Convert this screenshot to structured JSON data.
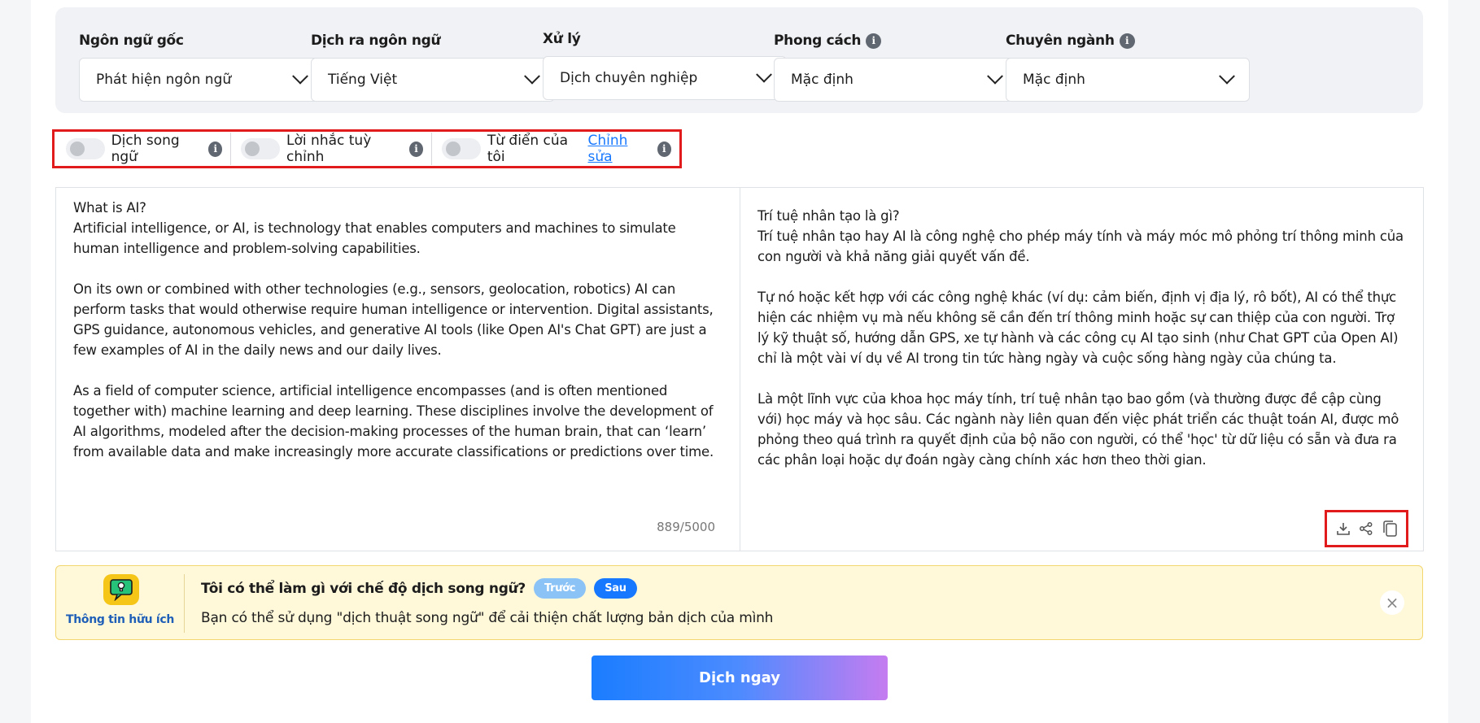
{
  "filters": [
    {
      "label": "Ngôn ngữ gốc",
      "value": "Phát hiện ngôn ngữ",
      "info": false
    },
    {
      "label": "Dịch ra ngôn ngữ",
      "value": "Tiếng Việt",
      "info": false
    },
    {
      "label": "Xử lý",
      "value": "Dịch chuyên nghiệp",
      "info": false
    },
    {
      "label": "Phong cách",
      "value": "Mặc định",
      "info": true
    },
    {
      "label": "Chuyên ngành",
      "value": "Mặc định",
      "info": true
    }
  ],
  "options": {
    "bilingual": "Dịch song ngữ",
    "custom_prompt": "Lời nhắc tuỳ chỉnh",
    "my_dictionary": "Từ điển của tôi",
    "edit_link": "Chỉnh sửa"
  },
  "source": {
    "text": "What is AI?\nArtificial intelligence, or AI, is technology that enables computers and machines to simulate human intelligence and problem-solving capabilities.\n\nOn its own or combined with other technologies (e.g., sensors, geolocation, robotics) AI can perform tasks that would otherwise require human intelligence or intervention. Digital assistants, GPS guidance, autonomous vehicles, and generative AI tools (like Open AI's Chat GPT) are just a few examples of AI in the daily news and our daily lives.\n\nAs a field of computer science, artificial intelligence encompasses (and is often mentioned together with) machine learning and deep learning. These disciplines involve the development of AI algorithms, modeled after the decision-making processes of the human brain, that can ‘learn’ from available data and make increasingly more accurate classifications or predictions over time.",
    "counter": "889/5000"
  },
  "target": {
    "text": "Trí tuệ nhân tạo là gì?\nTrí tuệ nhân tạo hay AI là công nghệ cho phép máy tính và máy móc mô phỏng trí thông minh của con người và khả năng giải quyết vấn đề.\n\nTự nó hoặc kết hợp với các công nghệ khác (ví dụ: cảm biến, định vị địa lý, rô bốt), AI có thể thực hiện các nhiệm vụ mà nếu không sẽ cần đến trí thông minh hoặc sự can thiệp của con người. Trợ lý kỹ thuật số, hướng dẫn GPS, xe tự hành và các công cụ AI tạo sinh (như Chat GPT của Open AI) chỉ là một vài ví dụ về AI trong tin tức hàng ngày và cuộc sống hàng ngày của chúng ta.\n\nLà một lĩnh vực của khoa học máy tính, trí tuệ nhân tạo bao gồm (và thường được đề cập cùng với) học máy và học sâu. Các ngành này liên quan đến việc phát triển các thuật toán AI, được mô phỏng theo quá trình ra quyết định của bộ não con người, có thể 'học' từ dữ liệu có sẵn và đưa ra các phân loại hoặc dự đoán ngày càng chính xác hơn theo thời gian."
  },
  "tip": {
    "caption": "Thông tin hữu ích",
    "title": "Tôi có thể làm gì với chế độ dịch song ngữ?",
    "prev": "Trước",
    "next": "Sau",
    "body": "Bạn có thể sử dụng \"dịch thuật song ngữ\" để cải thiện chất lượng bản dịch của mình",
    "close": "×"
  },
  "translate_button": "Dịch ngay",
  "colors": {
    "accent": "#1677ff",
    "highlight_border": "#e11b1b",
    "tip_bg": "#fff8d9"
  }
}
